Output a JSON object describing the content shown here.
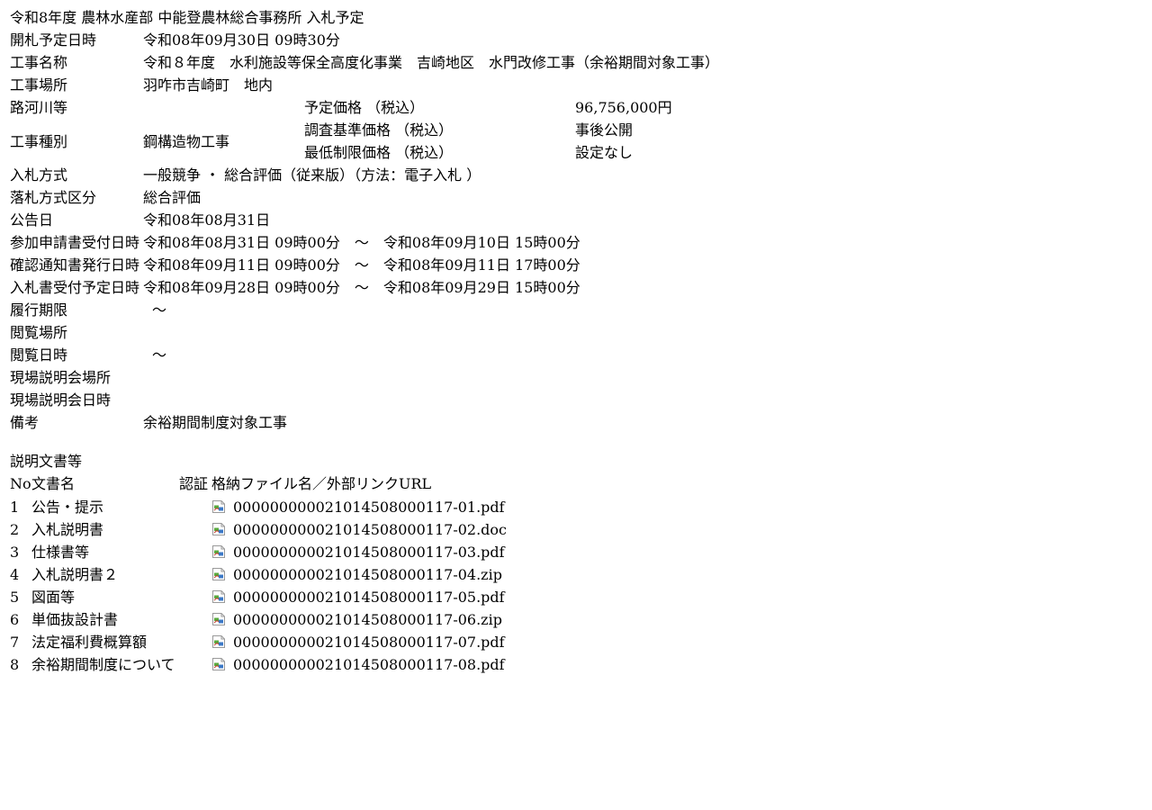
{
  "title": "令和8年度 農林水産部 中能登農林総合事務所 入札予定",
  "rows": {
    "kaisatsu_label": "開札予定日時",
    "kaisatsu_value": "令和08年09月30日 09時30分",
    "koji_meisho_label": "工事名称",
    "koji_meisho_value": "令和８年度　水利施設等保全高度化事業　吉崎地区　水門改修工事（余裕期間対象工事）",
    "koji_basho_label": "工事場所",
    "koji_basho_value": "羽咋市吉崎町　地内",
    "rokasen_label": "路河川等",
    "koji_shubetsu_label": "工事種別",
    "koji_shubetsu_value": "鋼構造物工事",
    "yotei_kakaku_label": "予定価格 （税込）",
    "yotei_kakaku_value": "96,756,000円",
    "chosa_kijun_label": "調査基準価格 （税込）",
    "chosa_kijun_value": "事後公開",
    "saitei_seigen_label": "最低制限価格 （税込）",
    "saitei_seigen_value": "設定なし",
    "nyusatsu_hoshiki_label": "入札方式",
    "nyusatsu_hoshiki_value": "一般競争 ・ 総合評価（従来版）（方法：電子入札 ）",
    "rakusatsu_label": "落札方式区分",
    "rakusatsu_value": "総合評価",
    "kokoku_label": "公告日",
    "kokoku_value": "令和08年08月31日",
    "sanka_label": "参加申請書受付日時",
    "sanka_value": "令和08年08月31日 09時00分　～　令和08年09月10日 15時00分",
    "kakunin_label": "確認通知書発行日時",
    "kakunin_value": "令和08年09月11日 09時00分　～　令和08年09月11日 17時00分",
    "nyusatsusho_label": "入札書受付予定日時",
    "nyusatsusho_value": "令和08年09月28日 09時00分　～　令和08年09月29日 15時00分",
    "riko_kigen_label": "履行期限",
    "riko_kigen_value": "～",
    "etsuran_basho_label": "閲覧場所",
    "etsuran_nichiji_label": "閲覧日時",
    "etsuran_nichiji_value": "～",
    "genba_basho_label": "現場説明会場所",
    "genba_nichiji_label": "現場説明会日時",
    "biko_label": "備考",
    "biko_value": "余裕期間制度対象工事"
  },
  "documents": {
    "section_title": "説明文書等",
    "header_no": "No",
    "header_name": "文書名",
    "header_auth": "認証",
    "header_file": "格納ファイル名／外部リンクURL",
    "items": [
      {
        "no": "1",
        "name": "公告・提示",
        "file": "000000000021014508000117-01.pdf"
      },
      {
        "no": "2",
        "name": "入札説明書",
        "file": "000000000021014508000117-02.doc"
      },
      {
        "no": "3",
        "name": "仕様書等",
        "file": "000000000021014508000117-03.pdf"
      },
      {
        "no": "4",
        "name": "入札説明書２",
        "file": "000000000021014508000117-04.zip"
      },
      {
        "no": "5",
        "name": "図面等",
        "file": "000000000021014508000117-05.pdf"
      },
      {
        "no": "6",
        "name": "単価抜設計書",
        "file": "000000000021014508000117-06.zip"
      },
      {
        "no": "7",
        "name": "法定福利費概算額",
        "file": "000000000021014508000117-07.pdf"
      },
      {
        "no": "8",
        "name": "余裕期間制度について",
        "file": "000000000021014508000117-08.pdf"
      }
    ]
  },
  "icons": {
    "download": "broken-image-icon"
  }
}
